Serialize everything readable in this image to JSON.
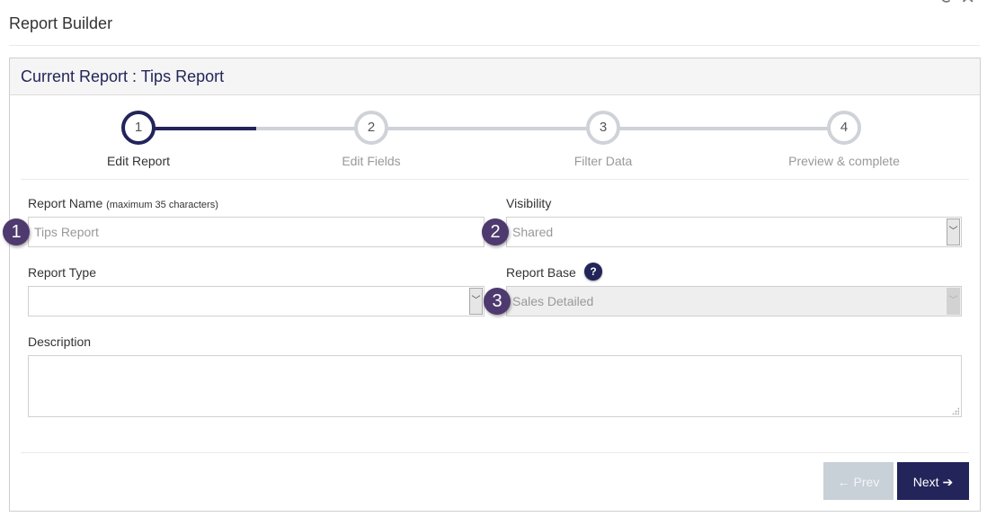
{
  "page": {
    "title": "Report Builder"
  },
  "panel": {
    "heading": "Current Report : Tips Report"
  },
  "wizard": {
    "current_step": 1,
    "steps": [
      {
        "number": "1",
        "label": "Edit Report",
        "active": true
      },
      {
        "number": "2",
        "label": "Edit Fields",
        "active": false
      },
      {
        "number": "3",
        "label": "Filter Data",
        "active": false
      },
      {
        "number": "4",
        "label": "Preview & complete",
        "active": false
      }
    ]
  },
  "form": {
    "report_name": {
      "label": "Report Name",
      "hint": "(maximum 35 characters)",
      "value": "Tips Report"
    },
    "visibility": {
      "label": "Visibility",
      "value": "Shared"
    },
    "report_type": {
      "label": "Report Type",
      "value": ""
    },
    "report_base": {
      "label": "Report Base",
      "value": "Sales Detailed",
      "disabled": true,
      "help_icon": "?"
    },
    "description": {
      "label": "Description",
      "value": ""
    }
  },
  "annotations": [
    "1",
    "2",
    "3"
  ],
  "buttons": {
    "prev": {
      "label": "Prev",
      "icon": "←"
    },
    "next": {
      "label": "Next",
      "icon": "➔"
    }
  },
  "colors": {
    "primary": "#22245a",
    "badge": "#4e3a6e",
    "disabled_button": "#c8d0d8"
  }
}
